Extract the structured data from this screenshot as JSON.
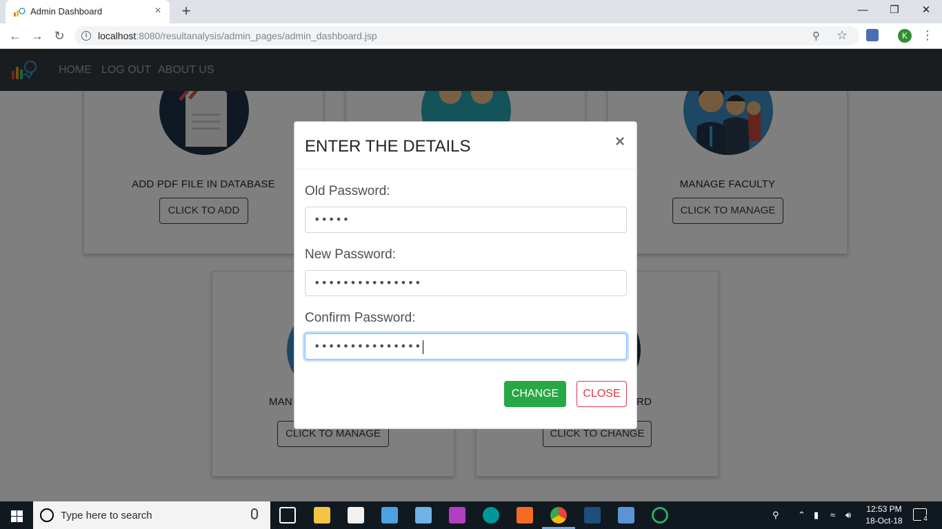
{
  "browser": {
    "tab_title": "Admin Dashboard",
    "tab_close": "×",
    "new_tab": "+",
    "url_host": "localhost",
    "url_rest": ":8080/resultanalysis/admin_pages/admin_dashboard.jsp",
    "profile_initial": "K"
  },
  "navbar": {
    "links": [
      "HOME",
      "LOG OUT",
      "ABOUT US"
    ]
  },
  "cards": [
    {
      "title": "ADD PDF FILE IN DATABASE",
      "button": "CLICK TO ADD"
    },
    {
      "title": "",
      "button": ""
    },
    {
      "title": "MANAGE FACULTY",
      "button": "CLICK TO MANAGE"
    },
    {
      "title": "MAN",
      "button": "CLICK TO MANAGE"
    },
    {
      "title": "RD",
      "button": "CLICK TO CHANGE"
    }
  ],
  "modal": {
    "title": "ENTER THE DETAILS",
    "close": "×",
    "fields": [
      {
        "label": "Old Password:",
        "value": "•••••"
      },
      {
        "label": "New Password:",
        "value": "•••••••••••••••"
      },
      {
        "label": "Confirm Password:",
        "value": "•••••••••••••••"
      }
    ],
    "change_button": "CHANGE",
    "close_button": "CLOSE"
  },
  "taskbar": {
    "search_placeholder": "Type here to search",
    "time": "12:53 PM",
    "date": "18-Oct-18",
    "notification_count": "4"
  },
  "colors": {
    "navbar_bg": "#343a40",
    "success": "#28a745",
    "danger": "#dc3545",
    "focus_ring": "#80bdff"
  }
}
